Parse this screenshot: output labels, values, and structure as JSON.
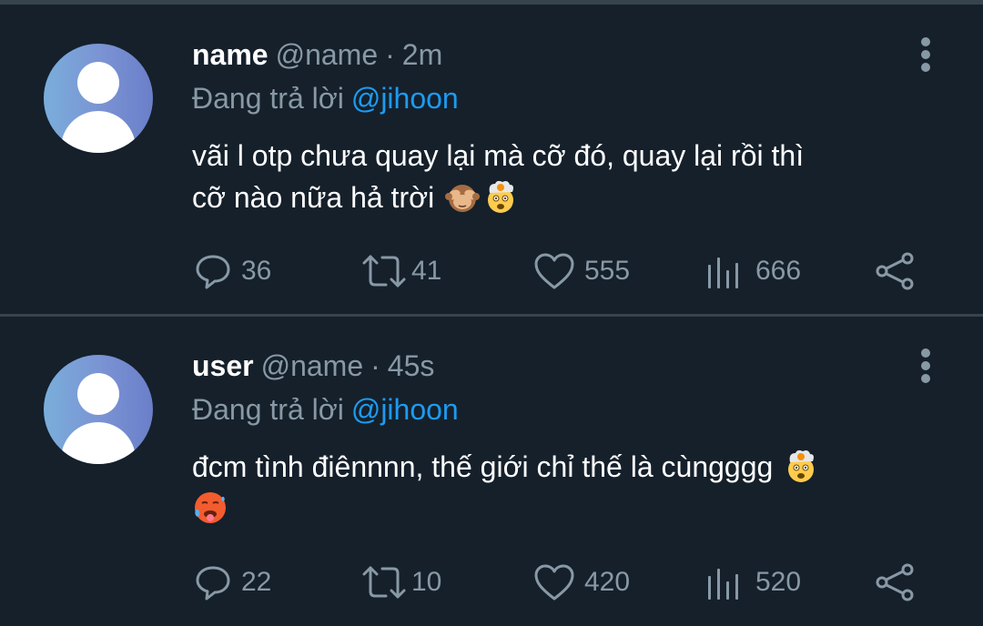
{
  "tweets": [
    {
      "display_name": "name",
      "handle": "@name",
      "separator": "·",
      "time": "2m",
      "reply_prefix": "Đang trả lời",
      "reply_to": "@jihoon",
      "text_line1": "vãi l otp chưa quay lại mà cỡ đó, quay lại rồi thì",
      "text_line2": "cỡ nào nữa hả trời",
      "emojis": [
        "see-no-evil-monkey",
        "exploding-head"
      ],
      "replies": "36",
      "retweets": "41",
      "likes": "555",
      "views": "666"
    },
    {
      "display_name": "user",
      "handle": "@name",
      "separator": "·",
      "time": "45s",
      "reply_prefix": "Đang trả lời",
      "reply_to": "@jihoon",
      "text_line1": "đcm tình điênnnn, thế giới chỉ thế là cùngggg",
      "text_line2": "",
      "emojis": [
        "exploding-head",
        "hot-face"
      ],
      "replies": "22",
      "retweets": "10",
      "likes": "420",
      "views": "520"
    }
  ],
  "colors": {
    "background": "#15202b",
    "divider": "#38444d",
    "muted": "#8899a6",
    "mention": "#1d9bf0",
    "text": "#ffffff"
  }
}
